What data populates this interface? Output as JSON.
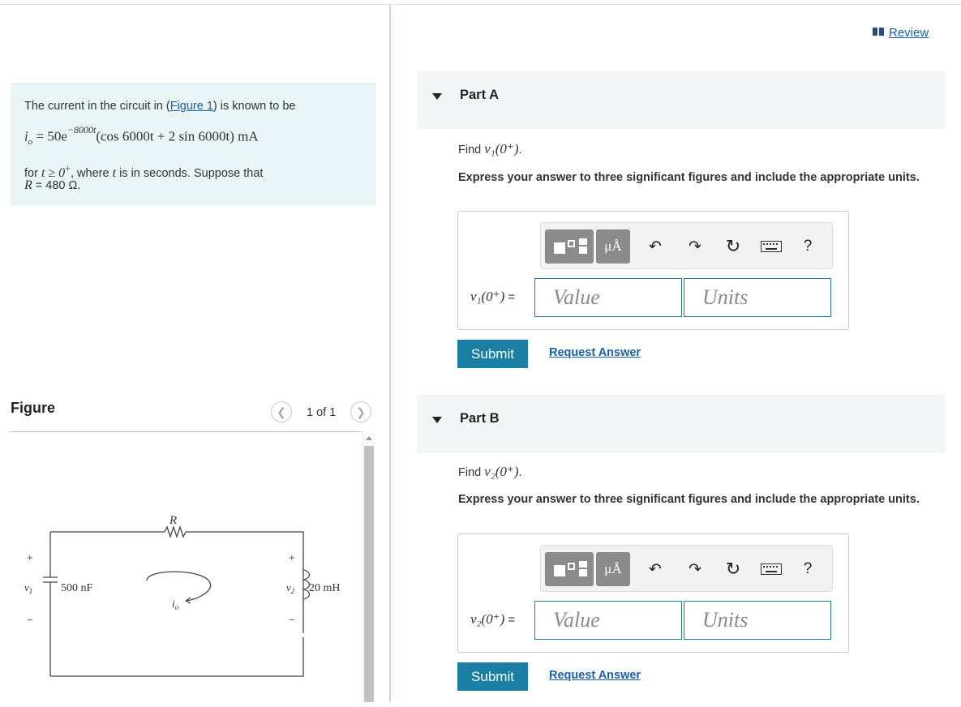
{
  "review": {
    "label": "Review"
  },
  "problem": {
    "intro_before": "The current in the circuit in (",
    "figure_link": "Figure 1",
    "intro_after": ") is known to be",
    "equation_lhs": "i",
    "equation_sub": "o",
    "equation_mid": " = 50e",
    "equation_exp": "−8000t",
    "equation_rhs": "(cos 6000t + 2 sin 6000t) mA",
    "condition_pre": "for ",
    "condition_math": "t ≥ 0",
    "condition_sup": "+",
    "condition_post": ", where ",
    "condition_t": "t",
    "condition_end": " is in seconds. Suppose that",
    "r_symbol": "R",
    "r_value": " = 480 Ω."
  },
  "figure": {
    "title": "Figure",
    "pager": "1 of 1",
    "labels": {
      "R": "R",
      "cap": "500 nF",
      "ind": "20 mH",
      "v1": "v",
      "v1sub": "1",
      "v2": "v",
      "v2sub": "2",
      "io": "i",
      "iosub": "o",
      "plus": "+",
      "minus": "−"
    }
  },
  "parts": [
    {
      "title": "Part A",
      "find_pre": "Find ",
      "find_math": "v₁(0⁺)",
      "find_post": ".",
      "instructions": "Express your answer to three significant figures and include the appropriate units.",
      "field_label": "v₁(0⁺)",
      "field_eq": " =",
      "value_placeholder": "Value",
      "units_placeholder": "Units",
      "submit": "Submit",
      "request": "Request Answer"
    },
    {
      "title": "Part B",
      "find_pre": "Find ",
      "find_math": "v₂(0⁺)",
      "find_post": ".",
      "instructions": "Express your answer to three significant figures and include the appropriate units.",
      "field_label": "v₂(0⁺)",
      "field_eq": " =",
      "value_placeholder": "Value",
      "units_placeholder": "Units",
      "submit": "Submit",
      "request": "Request Answer"
    }
  ],
  "toolbar": {
    "units_btn": "μÅ",
    "undo": "↶",
    "redo": "↷",
    "reset": "↻",
    "help": "?",
    "icons": [
      "templates-icon",
      "units-icon",
      "undo-icon",
      "redo-icon",
      "reset-icon",
      "keyboard-icon",
      "help-icon"
    ]
  }
}
